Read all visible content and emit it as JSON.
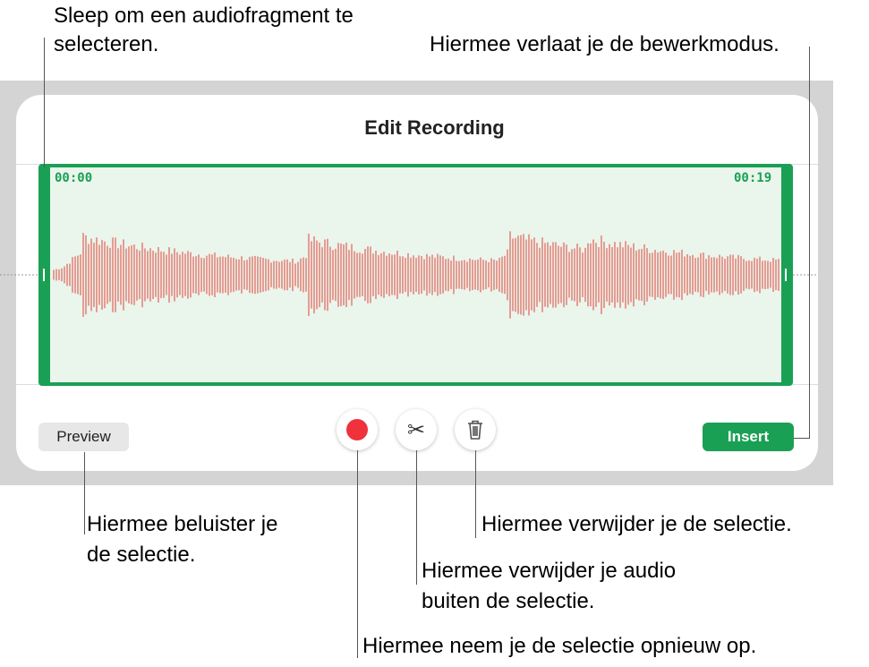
{
  "dialog": {
    "title": "Edit Recording",
    "start_time": "00:00",
    "end_time": "00:19",
    "preview_label": "Preview",
    "insert_label": "Insert"
  },
  "callouts": {
    "drag_line1": "Sleep om een audiofragment te",
    "drag_line2": "selecteren.",
    "exit": "Hiermee verlaat je de bewerkmodus.",
    "preview_line1": "Hiermee beluister je",
    "preview_line2": "de selectie.",
    "delete": "Hiermee verwijder je de selectie.",
    "trim_line1": "Hiermee verwijder je audio",
    "trim_line2": "buiten de selectie.",
    "record": "Hiermee neem je de selectie opnieuw op."
  },
  "colors": {
    "accent_green": "#1aa055",
    "waveform_red": "#e0443a",
    "record_red": "#f0323c"
  },
  "icons": {
    "record": "record-icon",
    "trim": "scissors-icon",
    "delete": "trash-icon"
  }
}
